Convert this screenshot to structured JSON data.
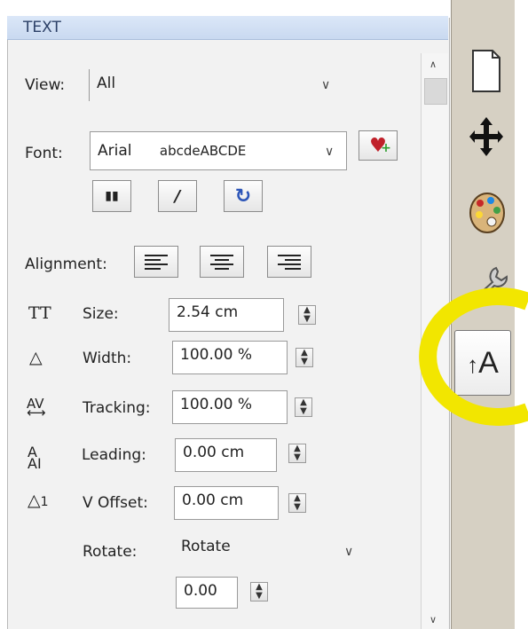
{
  "panel": {
    "title": "TEXT",
    "view_label": "View:",
    "view_value": "All",
    "font_label": "Font:",
    "font_value": "Arial",
    "font_sample": "abcdeABCDE",
    "alignment_label": "Alignment:",
    "size_label": "Size:",
    "size_value": "2.54 cm",
    "width_label": "Width:",
    "width_value": "100.00 %",
    "tracking_label": "Tracking:",
    "tracking_value": "100.00 %",
    "leading_label": "Leading:",
    "leading_value": "0.00 cm",
    "voffset_label": "V Offset:",
    "voffset_value": "0.00 cm",
    "rotate_label": "Rotate:",
    "rotate_select": "Rotate",
    "rotate_value": "0.00",
    "bold_label": "B",
    "italic_label": "I",
    "reset_label": "C"
  },
  "sidebar": {
    "text_tool_label": "A",
    "icons": [
      "page-icon",
      "move-icon",
      "palette-icon",
      "wrench-icon",
      "text-icon"
    ]
  },
  "annotations": {
    "highlight_color": "#f2e600"
  }
}
